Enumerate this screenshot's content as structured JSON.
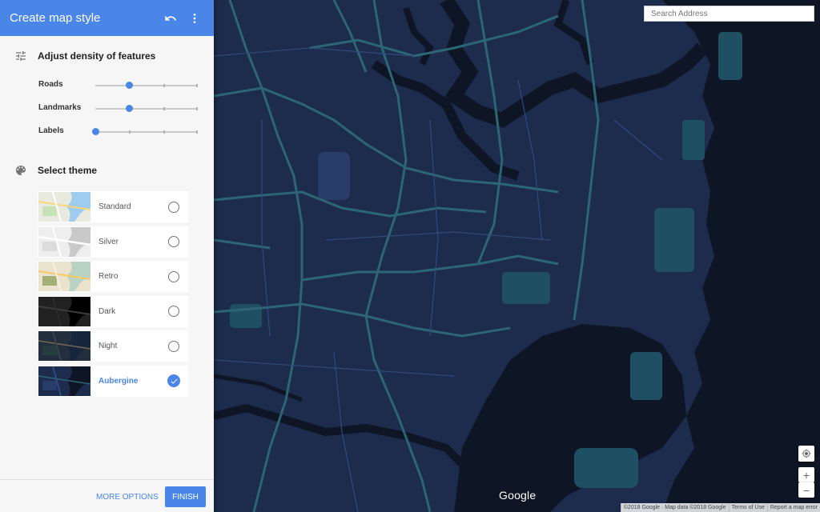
{
  "header": {
    "title": "Create map style",
    "undo_icon": "undo-icon",
    "menu_icon": "more-vert-icon"
  },
  "density": {
    "title": "Adjust density of features",
    "icon": "tune-icon",
    "sliders": [
      {
        "label": "Roads",
        "level": 0.33
      },
      {
        "label": "Landmarks",
        "level": 0.33
      },
      {
        "label": "Labels",
        "level": 0.0
      }
    ]
  },
  "themes": {
    "title": "Select theme",
    "icon": "palette-icon",
    "items": [
      {
        "label": "Standard",
        "selected": false
      },
      {
        "label": "Silver",
        "selected": false
      },
      {
        "label": "Retro",
        "selected": false
      },
      {
        "label": "Dark",
        "selected": false
      },
      {
        "label": "Night",
        "selected": false
      },
      {
        "label": "Aubergine",
        "selected": true
      }
    ]
  },
  "footer": {
    "more_options": "MORE OPTIONS",
    "finish": "FINISH"
  },
  "map": {
    "search_placeholder": "Search Address",
    "logo": "Google",
    "attribution": {
      "data": "©2018 Google · Map data ©2018 Google",
      "terms": "Terms of Use",
      "report": "Report a map error"
    },
    "zoom_in": "+",
    "zoom_out": "−"
  },
  "colors": {
    "accent": "#4a86e8",
    "land": "#1d2c4d",
    "water": "#0e1626",
    "road": "#304a7d",
    "park": "#283d6a",
    "highway": "#2c6675"
  }
}
